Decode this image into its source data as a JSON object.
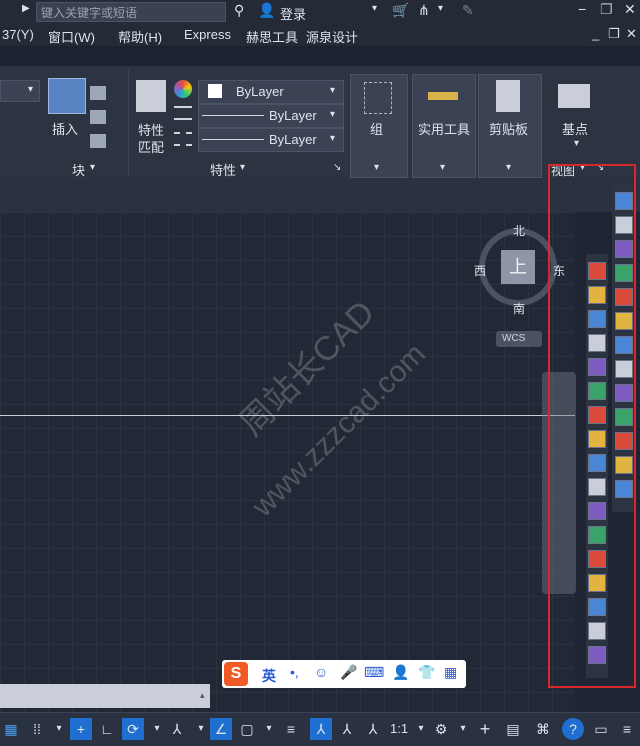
{
  "search": {
    "placeholder": "键入关键字或短语"
  },
  "header": {
    "login_label": "登录"
  },
  "menu": {
    "items": [
      "37(Y)",
      "窗口(W)",
      "帮助(H)",
      "Express",
      "赫思工具",
      "源泉设计"
    ]
  },
  "ribbon": {
    "insert_label": "插入",
    "block_panel_label": "块",
    "match_props_label": "特性\n匹配",
    "match_line1": "特性",
    "match_line2": "匹配",
    "layer_values": [
      "ByLayer",
      "ByLayer",
      "ByLayer"
    ],
    "properties_panel_label": "特性",
    "group_label": "组",
    "utilities_label": "实用工具",
    "clipboard_label": "剪贴板",
    "base_label": "基点",
    "view_label": "视图"
  },
  "viewcube": {
    "north": "北",
    "south": "南",
    "east": "东",
    "west": "西",
    "face": "上",
    "wcs": "WCS"
  },
  "ime": {
    "mode": "英"
  },
  "status": {
    "scale": "1:1"
  },
  "watermark": {
    "line1": "周站长CAD",
    "line2": "www.zzzcad.com"
  },
  "colors": {
    "accent": "#1e6fd0",
    "highlight_box": "#d8282e",
    "bg": "#1f2533"
  }
}
